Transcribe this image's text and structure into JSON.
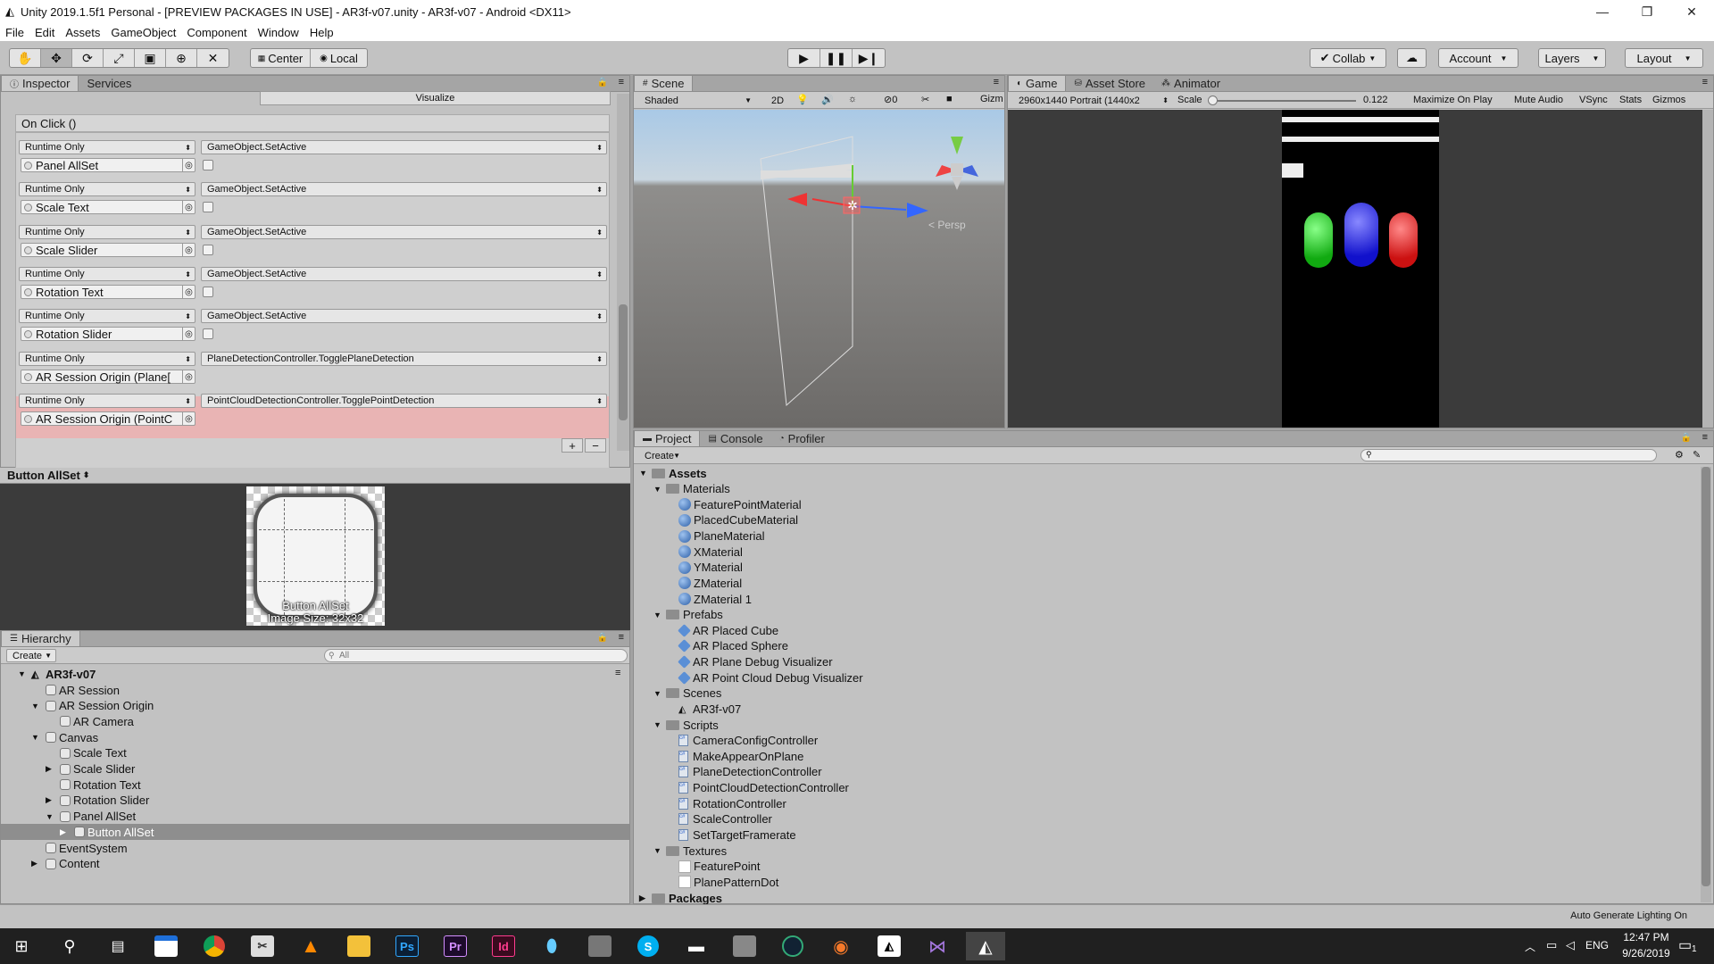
{
  "window": {
    "title": "Unity 2019.1.5f1 Personal - [PREVIEW PACKAGES IN USE] - AR3f-v07.unity - AR3f-v07 - Android <DX11>",
    "min": "—",
    "max": "❐",
    "close": "✕"
  },
  "menu": [
    "File",
    "Edit",
    "Assets",
    "GameObject",
    "Component",
    "Window",
    "Help"
  ],
  "toolbar": {
    "center": "Center",
    "local": "Local",
    "collab": "Collab",
    "account": "Account",
    "layers": "Layers",
    "layout": "Layout"
  },
  "inspector": {
    "tabs": [
      "Inspector",
      "Services"
    ],
    "visualize": "Visualize",
    "onclick": "On Click ()",
    "events": [
      {
        "mode": "Runtime Only",
        "func": "GameObject.SetActive",
        "obj": "Panel AllSet"
      },
      {
        "mode": "Runtime Only",
        "func": "GameObject.SetActive",
        "obj": "Scale Text"
      },
      {
        "mode": "Runtime Only",
        "func": "GameObject.SetActive",
        "obj": "Scale Slider"
      },
      {
        "mode": "Runtime Only",
        "func": "GameObject.SetActive",
        "obj": "Rotation Text"
      },
      {
        "mode": "Runtime Only",
        "func": "GameObject.SetActive",
        "obj": "Rotation Slider"
      },
      {
        "mode": "Runtime Only",
        "func": "PlaneDetectionController.TogglePlaneDetection",
        "obj": "AR Session Origin (Plane["
      },
      {
        "mode": "Runtime Only",
        "func": "PointCloudDetectionController.TogglePointDetection",
        "obj": "AR Session Origin (PointC"
      }
    ],
    "plus": "+",
    "minus": "−"
  },
  "preview": {
    "title": "Button AllSet",
    "caption1": "Button AllSet",
    "caption2": "Image Size: 32x32"
  },
  "hierarchy": {
    "tab": "Hierarchy",
    "create": "Create",
    "search_placeholder": "All",
    "scene": "AR3f-v07",
    "items": [
      "AR Session",
      "AR Session Origin",
      "AR Camera",
      "Canvas",
      "Scale Text",
      "Scale Slider",
      "Rotation Text",
      "Rotation Slider",
      "Panel AllSet",
      "Button AllSet",
      "EventSystem",
      "Content"
    ]
  },
  "scene": {
    "tab": "Scene",
    "shading": "Shaded",
    "mode2d": "2D",
    "fx": "0",
    "gizmos": "Gizm",
    "persp": "< Persp"
  },
  "game": {
    "tabs": [
      "Game",
      "Asset Store",
      "Animator"
    ],
    "resolution": "2960x1440 Portrait (1440x2",
    "scale_label": "Scale",
    "scale_value": "0.122",
    "buttons": [
      "Maximize On Play",
      "Mute Audio",
      "VSync",
      "Stats",
      "Gizmos"
    ]
  },
  "project": {
    "tabs": [
      "Project",
      "Console",
      "Profiler"
    ],
    "create": "Create",
    "assets": "Assets",
    "materials_folder": "Materials",
    "materials": [
      "FeaturePointMaterial",
      "PlacedCubeMaterial",
      "PlaneMaterial",
      "XMaterial",
      "YMaterial",
      "ZMaterial",
      "ZMaterial 1"
    ],
    "prefabs_folder": "Prefabs",
    "prefabs": [
      "AR Placed Cube",
      "AR Placed Sphere",
      "AR Plane Debug Visualizer",
      "AR Point Cloud Debug Visualizer"
    ],
    "scenes_folder": "Scenes",
    "scenes": [
      "AR3f-v07"
    ],
    "scripts_folder": "Scripts",
    "scripts": [
      "CameraConfigController",
      "MakeAppearOnPlane",
      "PlaneDetectionController",
      "PointCloudDetectionController",
      "RotationController",
      "ScaleController",
      "SetTargetFramerate"
    ],
    "textures_folder": "Textures",
    "textures": [
      "FeaturePoint",
      "PlanePatternDot"
    ],
    "packages": "Packages"
  },
  "status": "Auto Generate Lighting On",
  "taskbar": {
    "time": "12:47 PM",
    "date": "9/26/2019",
    "lang": "ENG",
    "notif": "1"
  }
}
